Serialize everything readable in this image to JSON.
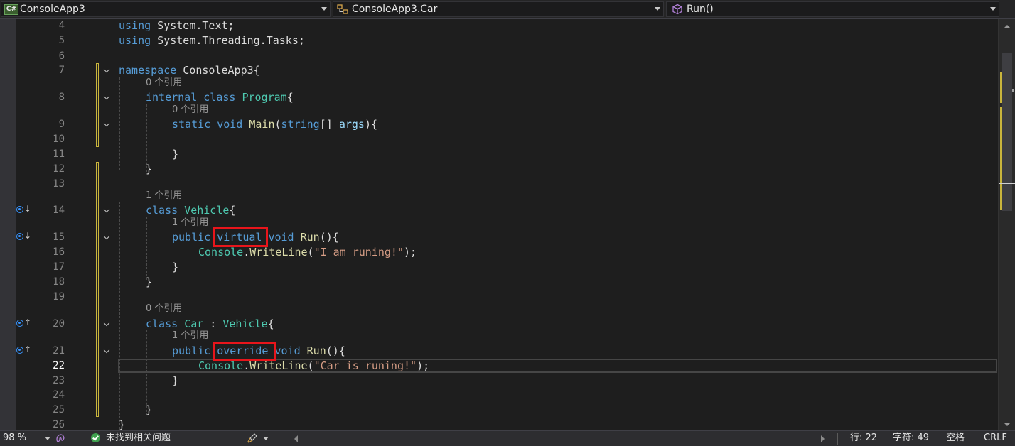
{
  "navbar": {
    "project": {
      "badge": "C#",
      "label": "ConsoleApp3"
    },
    "type_scope": {
      "label": "ConsoleApp3.Car"
    },
    "member": {
      "label": "Run()"
    }
  },
  "editor": {
    "line_numbers": [
      "4",
      "5",
      "6",
      "7",
      "8",
      "9",
      "10",
      "11",
      "12",
      "13",
      "14",
      "15",
      "16",
      "17",
      "18",
      "19",
      "20",
      "21",
      "22",
      "23",
      "24",
      "25",
      "26"
    ],
    "current_line": "22",
    "code": {
      "l4_kw": "using",
      "l4_rest": " System.Text;",
      "l5_kw": "using",
      "l5_rest": " System.Threading.Tasks;",
      "l7_kw": "namespace",
      "l7_rest": " ConsoleApp3{",
      "l8_kw1": "internal",
      "l8_kw2": "class",
      "l8_cls": "Program",
      "l8_rest": "{",
      "l9_kw1": "static",
      "l9_kw2": "void",
      "l9_mth": "Main",
      "l9_p1": "(",
      "l9_kw3": "string",
      "l9_p2": "[] ",
      "l9_prm": "args",
      "l9_p3": "){",
      "l11": "}",
      "l12": "}",
      "l14_kw": "class",
      "l14_cls": "Vehicle",
      "l14_rest": "{",
      "l15_kw1": "public",
      "l15_kw2": "virtual",
      "l15_kw3": "void",
      "l15_mth": "Run",
      "l15_rest": "(){",
      "l16_cls": "Console",
      "l16_dot": ".",
      "l16_mth": "WriteLine",
      "l16_p1": "(",
      "l16_str": "\"I am runing!\"",
      "l16_p2": ");",
      "l17": "}",
      "l18": "}",
      "l20_kw": "class",
      "l20_cls": "Car",
      "l20_colon": " : ",
      "l20_base": "Vehicle",
      "l20_rest": "{",
      "l21_kw1": "public",
      "l21_kw2": "override",
      "l21_kw3": "void",
      "l21_mth": "Run",
      "l21_rest": "(){",
      "l22_cls": "Console",
      "l22_dot": ".",
      "l22_mth": "WriteLine",
      "l22_p1": "(",
      "l22_str": "\"Car is runing!\"",
      "l22_p2": ");",
      "l23": "}",
      "l25": "}",
      "l26": "}"
    },
    "codelens": {
      "program": "0 个引用",
      "main": "0 个引用",
      "vehicle": "1 个引用",
      "vehicle_run": "1 个引用",
      "car": "0 个引用",
      "car_run": "1 个引用"
    },
    "glyph_arrows": {
      "l14": "↓",
      "l15": "↓",
      "l20": "↑",
      "l21": "↑"
    }
  },
  "statusbar": {
    "zoom": "98 %",
    "issues": "未找到相关问题",
    "line": "行: 22",
    "char": "字符: 49",
    "whitespace": "空格",
    "line_ending": "CRLF"
  },
  "colors": {
    "keyword": "#569cd6",
    "class": "#4ec9b0",
    "method": "#dcdcaa",
    "string": "#d69d85",
    "parameter": "#9cdcfe",
    "highlight_box": "#e8151b",
    "change_bar": "#c9b53c"
  }
}
